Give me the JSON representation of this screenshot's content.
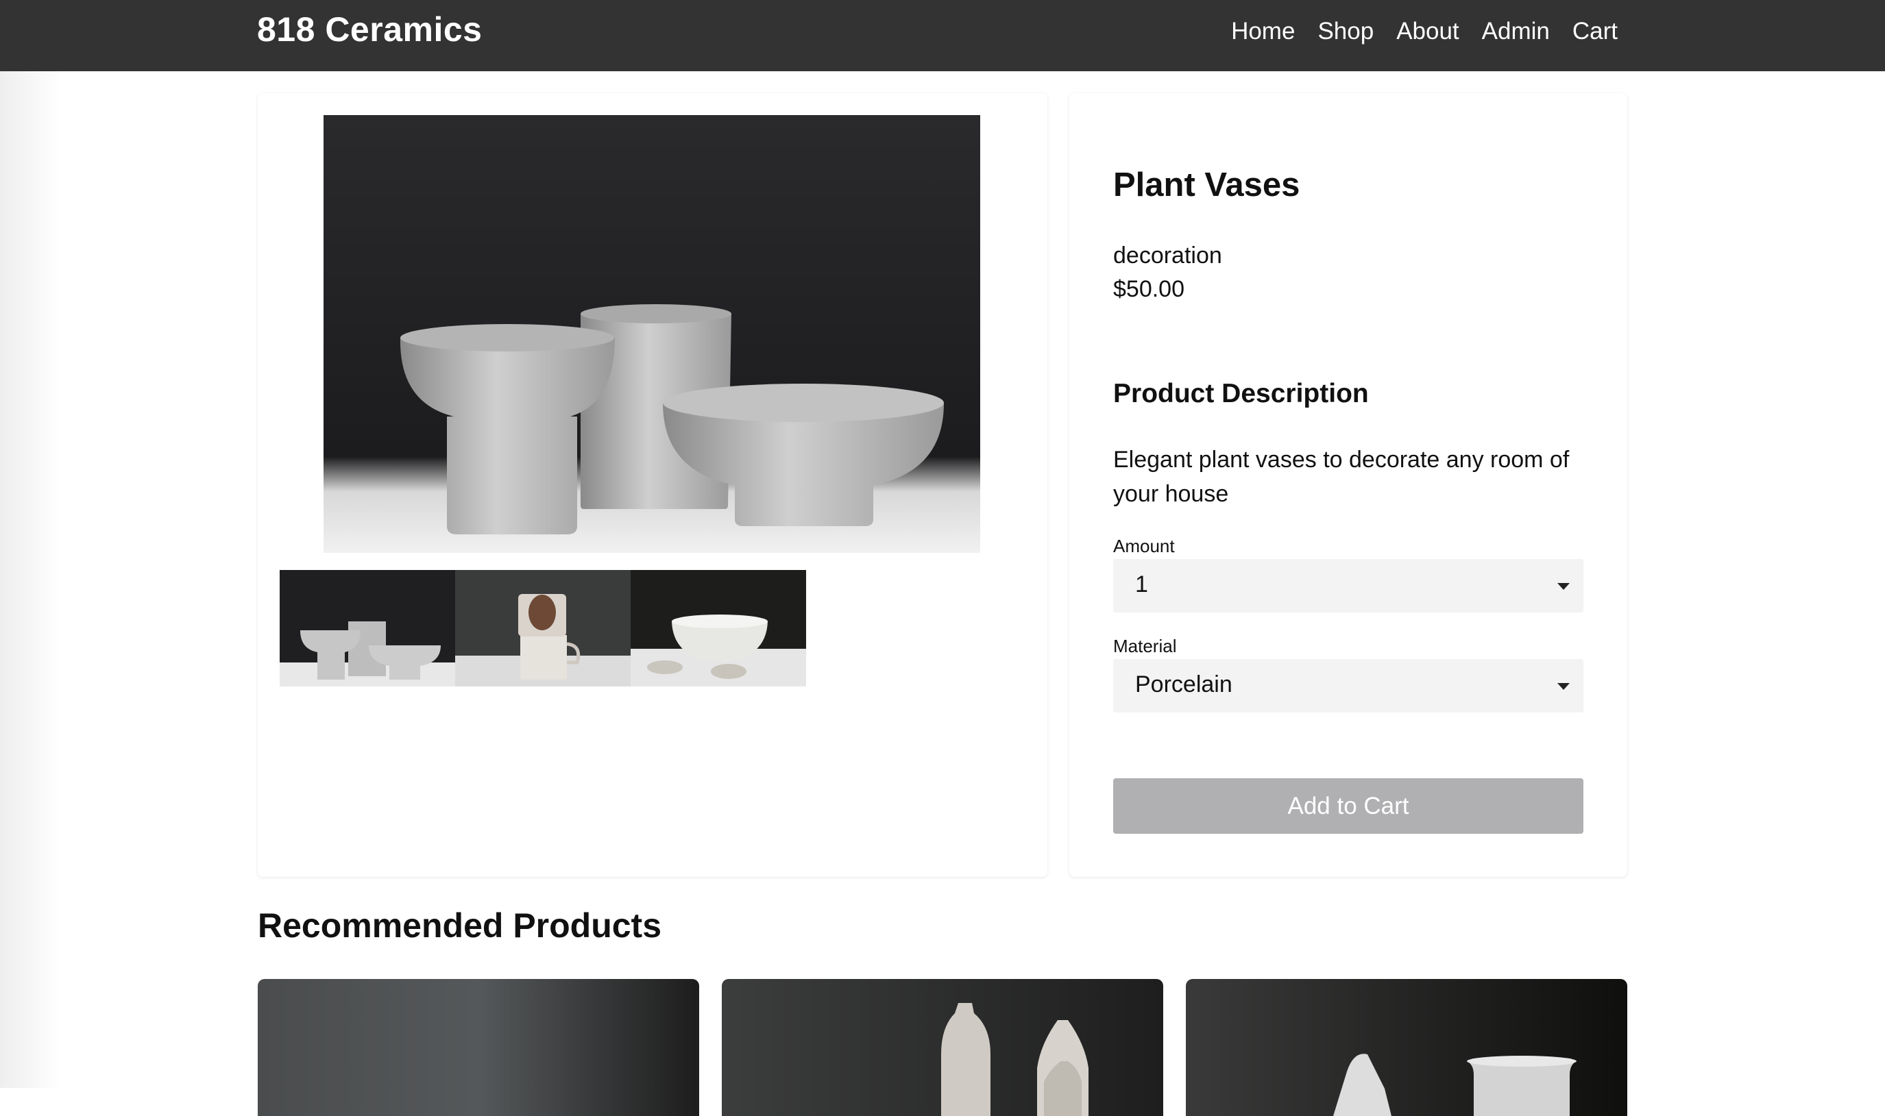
{
  "brand": "818 Ceramics",
  "nav": {
    "home": "Home",
    "shop": "Shop",
    "about": "About",
    "admin": "Admin",
    "cart": "Cart"
  },
  "product": {
    "title": "Plant Vases",
    "category": "decoration",
    "price": "$50.00",
    "description_heading": "Product Description",
    "description": "Elegant plant vases to decorate any room of your house"
  },
  "form": {
    "amount_label": "Amount",
    "amount_value": "1",
    "material_label": "Material",
    "material_value": "Porcelain",
    "add_to_cart": "Add to Cart"
  },
  "recommended": {
    "heading": "Recommended Products"
  },
  "colors": {
    "navbar": "#333333",
    "button_disabled": "#b0b0b2",
    "select_bg": "#f3f3f3"
  }
}
